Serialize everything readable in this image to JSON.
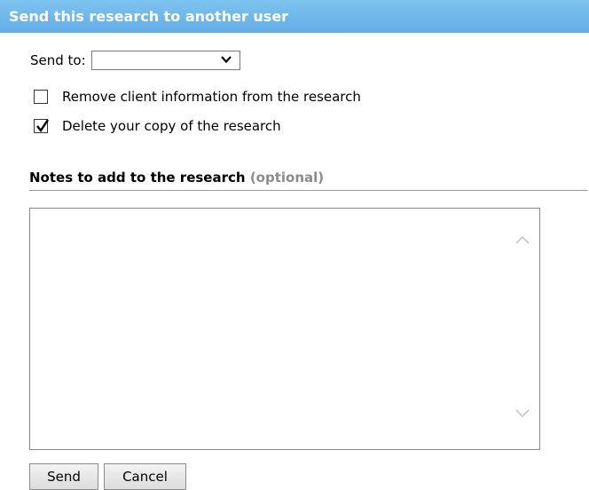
{
  "dialog": {
    "title": "Send this research to another user"
  },
  "send_to": {
    "label": "Send to:",
    "selected_value": ""
  },
  "options": [
    {
      "label": "Remove client information from the research",
      "checked": false
    },
    {
      "label": "Delete your copy of the research",
      "checked": true
    }
  ],
  "notes": {
    "heading": "Notes to add to the research",
    "optional_label": "(optional)",
    "value": ""
  },
  "buttons": {
    "send_label": "Send",
    "cancel_label": "Cancel"
  }
}
